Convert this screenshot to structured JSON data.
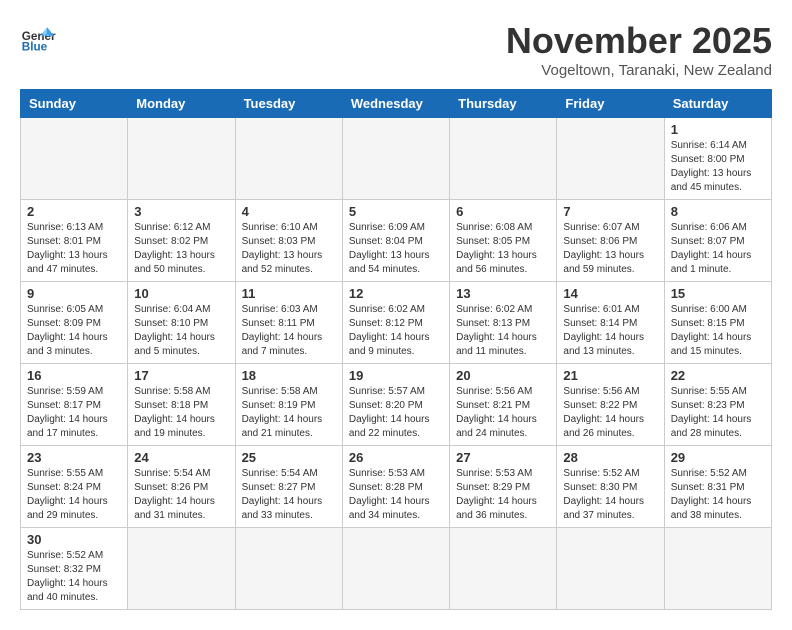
{
  "header": {
    "logo_general": "General",
    "logo_blue": "Blue",
    "title": "November 2025",
    "location": "Vogeltown, Taranaki, New Zealand"
  },
  "days_of_week": [
    "Sunday",
    "Monday",
    "Tuesday",
    "Wednesday",
    "Thursday",
    "Friday",
    "Saturday"
  ],
  "weeks": [
    [
      {
        "day": "",
        "info": ""
      },
      {
        "day": "",
        "info": ""
      },
      {
        "day": "",
        "info": ""
      },
      {
        "day": "",
        "info": ""
      },
      {
        "day": "",
        "info": ""
      },
      {
        "day": "",
        "info": ""
      },
      {
        "day": "1",
        "info": "Sunrise: 6:14 AM\nSunset: 8:00 PM\nDaylight: 13 hours and 45 minutes."
      }
    ],
    [
      {
        "day": "2",
        "info": "Sunrise: 6:13 AM\nSunset: 8:01 PM\nDaylight: 13 hours and 47 minutes."
      },
      {
        "day": "3",
        "info": "Sunrise: 6:12 AM\nSunset: 8:02 PM\nDaylight: 13 hours and 50 minutes."
      },
      {
        "day": "4",
        "info": "Sunrise: 6:10 AM\nSunset: 8:03 PM\nDaylight: 13 hours and 52 minutes."
      },
      {
        "day": "5",
        "info": "Sunrise: 6:09 AM\nSunset: 8:04 PM\nDaylight: 13 hours and 54 minutes."
      },
      {
        "day": "6",
        "info": "Sunrise: 6:08 AM\nSunset: 8:05 PM\nDaylight: 13 hours and 56 minutes."
      },
      {
        "day": "7",
        "info": "Sunrise: 6:07 AM\nSunset: 8:06 PM\nDaylight: 13 hours and 59 minutes."
      },
      {
        "day": "8",
        "info": "Sunrise: 6:06 AM\nSunset: 8:07 PM\nDaylight: 14 hours and 1 minute."
      }
    ],
    [
      {
        "day": "9",
        "info": "Sunrise: 6:05 AM\nSunset: 8:09 PM\nDaylight: 14 hours and 3 minutes."
      },
      {
        "day": "10",
        "info": "Sunrise: 6:04 AM\nSunset: 8:10 PM\nDaylight: 14 hours and 5 minutes."
      },
      {
        "day": "11",
        "info": "Sunrise: 6:03 AM\nSunset: 8:11 PM\nDaylight: 14 hours and 7 minutes."
      },
      {
        "day": "12",
        "info": "Sunrise: 6:02 AM\nSunset: 8:12 PM\nDaylight: 14 hours and 9 minutes."
      },
      {
        "day": "13",
        "info": "Sunrise: 6:02 AM\nSunset: 8:13 PM\nDaylight: 14 hours and 11 minutes."
      },
      {
        "day": "14",
        "info": "Sunrise: 6:01 AM\nSunset: 8:14 PM\nDaylight: 14 hours and 13 minutes."
      },
      {
        "day": "15",
        "info": "Sunrise: 6:00 AM\nSunset: 8:15 PM\nDaylight: 14 hours and 15 minutes."
      }
    ],
    [
      {
        "day": "16",
        "info": "Sunrise: 5:59 AM\nSunset: 8:17 PM\nDaylight: 14 hours and 17 minutes."
      },
      {
        "day": "17",
        "info": "Sunrise: 5:58 AM\nSunset: 8:18 PM\nDaylight: 14 hours and 19 minutes."
      },
      {
        "day": "18",
        "info": "Sunrise: 5:58 AM\nSunset: 8:19 PM\nDaylight: 14 hours and 21 minutes."
      },
      {
        "day": "19",
        "info": "Sunrise: 5:57 AM\nSunset: 8:20 PM\nDaylight: 14 hours and 22 minutes."
      },
      {
        "day": "20",
        "info": "Sunrise: 5:56 AM\nSunset: 8:21 PM\nDaylight: 14 hours and 24 minutes."
      },
      {
        "day": "21",
        "info": "Sunrise: 5:56 AM\nSunset: 8:22 PM\nDaylight: 14 hours and 26 minutes."
      },
      {
        "day": "22",
        "info": "Sunrise: 5:55 AM\nSunset: 8:23 PM\nDaylight: 14 hours and 28 minutes."
      }
    ],
    [
      {
        "day": "23",
        "info": "Sunrise: 5:55 AM\nSunset: 8:24 PM\nDaylight: 14 hours and 29 minutes."
      },
      {
        "day": "24",
        "info": "Sunrise: 5:54 AM\nSunset: 8:26 PM\nDaylight: 14 hours and 31 minutes."
      },
      {
        "day": "25",
        "info": "Sunrise: 5:54 AM\nSunset: 8:27 PM\nDaylight: 14 hours and 33 minutes."
      },
      {
        "day": "26",
        "info": "Sunrise: 5:53 AM\nSunset: 8:28 PM\nDaylight: 14 hours and 34 minutes."
      },
      {
        "day": "27",
        "info": "Sunrise: 5:53 AM\nSunset: 8:29 PM\nDaylight: 14 hours and 36 minutes."
      },
      {
        "day": "28",
        "info": "Sunrise: 5:52 AM\nSunset: 8:30 PM\nDaylight: 14 hours and 37 minutes."
      },
      {
        "day": "29",
        "info": "Sunrise: 5:52 AM\nSunset: 8:31 PM\nDaylight: 14 hours and 38 minutes."
      }
    ],
    [
      {
        "day": "30",
        "info": "Sunrise: 5:52 AM\nSunset: 8:32 PM\nDaylight: 14 hours and 40 minutes."
      },
      {
        "day": "",
        "info": ""
      },
      {
        "day": "",
        "info": ""
      },
      {
        "day": "",
        "info": ""
      },
      {
        "day": "",
        "info": ""
      },
      {
        "day": "",
        "info": ""
      },
      {
        "day": "",
        "info": ""
      }
    ]
  ]
}
